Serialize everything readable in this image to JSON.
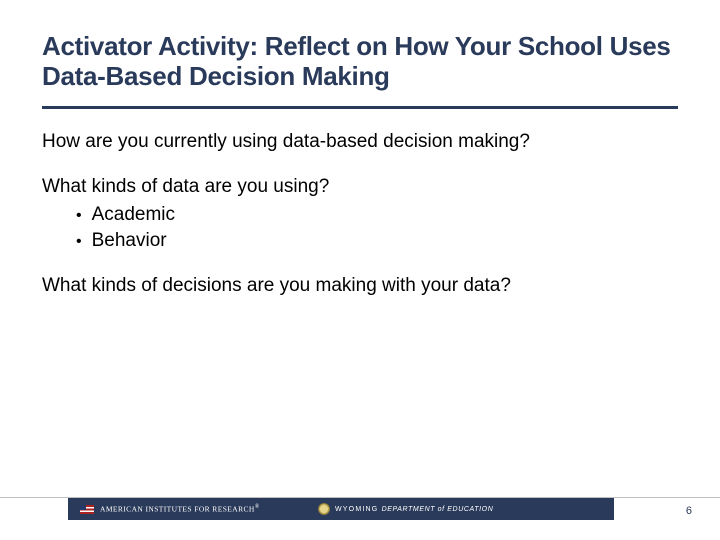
{
  "title": "Activator Activity: Reflect on How Your School Uses Data-Based Decision Making",
  "questions": {
    "q1": "How are you currently using data-based decision making?",
    "q2": "What kinds of data are you using?",
    "q3": "What kinds of decisions are you making with your data?"
  },
  "bullets": [
    "Academic",
    "Behavior"
  ],
  "footer": {
    "leftLogo": "AMERICAN INSTITUTES FOR RESEARCH",
    "reg": "®",
    "wyoming": "WYOMING",
    "wyomingDept": "DEPARTMENT of EDUCATION"
  },
  "pageNumber": "6"
}
